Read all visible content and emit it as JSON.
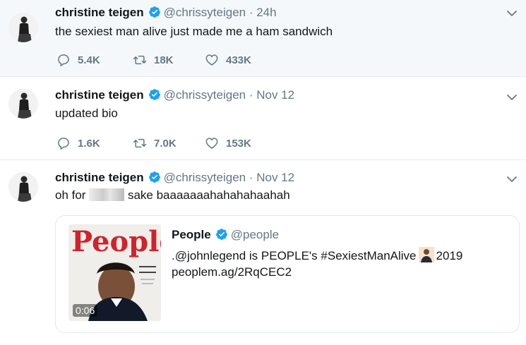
{
  "colors": {
    "text": "#14171a",
    "secondary": "#657786",
    "verified": "#1da1f2",
    "border": "#e6ecf0",
    "highlight_bg": "#f5f8fa"
  },
  "tweets": [
    {
      "name": "christine teigen",
      "handle": "@chrissyteigen",
      "time": "· 24h",
      "text": "the sexiest man alive just made me a ham sandwich",
      "replies": "5.4K",
      "retweets": "18K",
      "likes": "433K"
    },
    {
      "name": "christine teigen",
      "handle": "@chrissyteigen",
      "time": "· Nov 12",
      "text": "updated bio",
      "replies": "1.6K",
      "retweets": "7.0K",
      "likes": "153K"
    },
    {
      "name": "christine teigen",
      "handle": "@chrissyteigen",
      "time": "· Nov 12",
      "text_before": "oh for",
      "text_after": "sake baaaaaaahahahahaahah",
      "quote": {
        "name": "People",
        "handle": "@people",
        "line1_before": ".@johnlegend is PEOPLE's #SexiestManAlive",
        "line1_after": "2019",
        "line2": "peoplem.ag/2RqCEC2",
        "cover_title": "People",
        "duration": "0:06"
      }
    }
  ],
  "icons": [
    "reply-icon",
    "retweet-icon",
    "like-icon",
    "verified-icon",
    "chevron-down-icon"
  ]
}
